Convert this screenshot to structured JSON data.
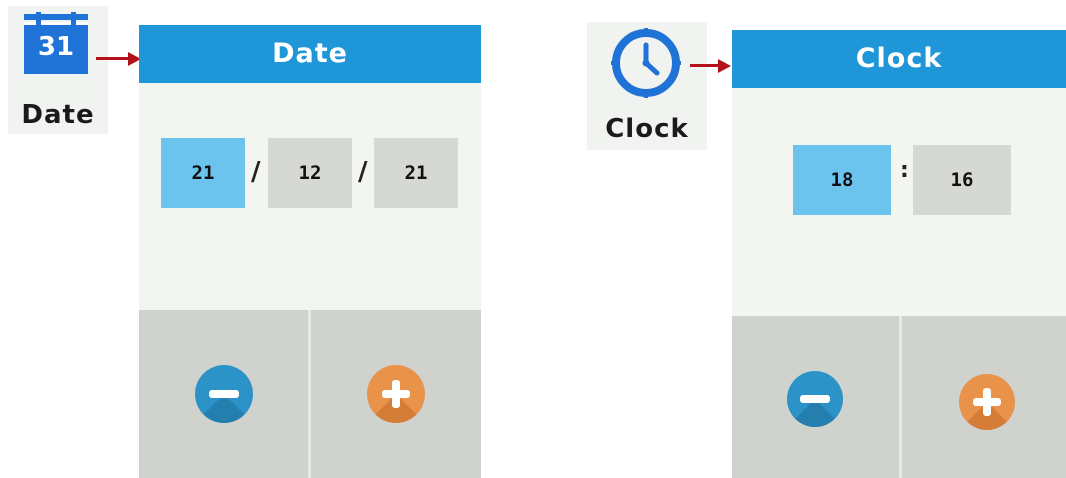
{
  "date_app": {
    "icon_label": "Date",
    "icon_number": "31",
    "header_title": "Date",
    "fields": [
      "21",
      "12",
      "21"
    ],
    "separator": "/"
  },
  "clock_app": {
    "icon_label": "Clock",
    "header_title": "Clock",
    "fields": [
      "18",
      "16"
    ],
    "separator": ":"
  },
  "icons": {
    "calendar": "calendar-icon",
    "clock": "clock-icon",
    "minus": "minus-icon",
    "plus": "plus-icon",
    "arrow": "arrow-right-icon"
  },
  "colors": {
    "header": "#1f96d8",
    "active_field": "#6cc3ee",
    "inactive_field": "#d6d8d3",
    "minus_button": "#2b93c8",
    "plus_button": "#e8924a",
    "arrow": "#b3121a"
  }
}
